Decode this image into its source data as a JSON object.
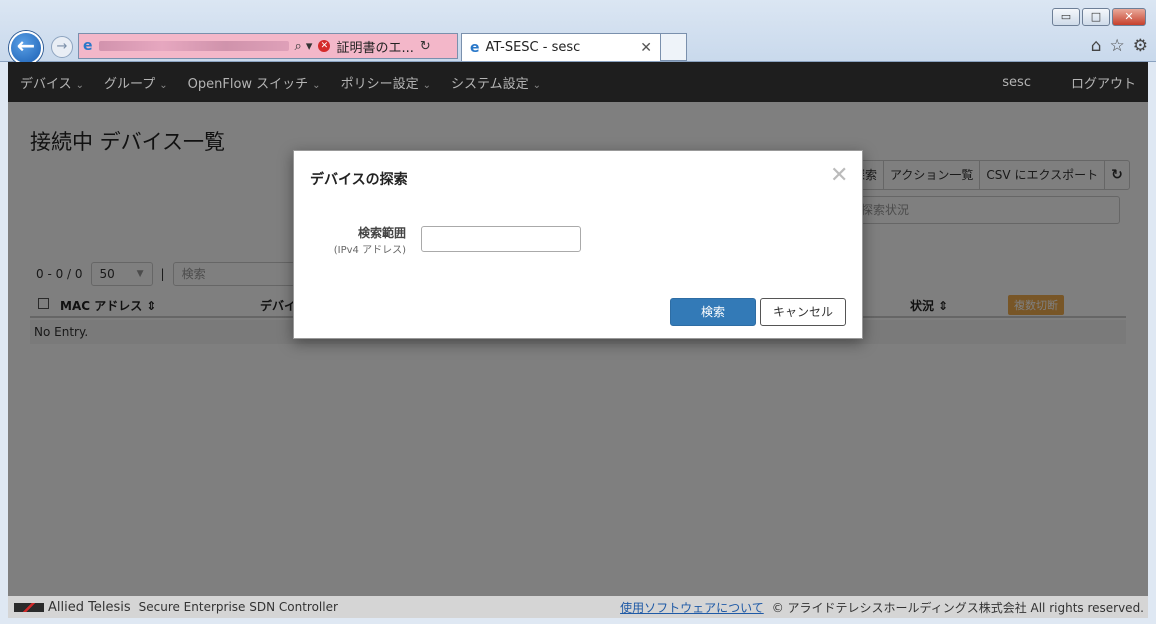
{
  "browser": {
    "window_buttons": {
      "minimize": "▭",
      "maximize": "□",
      "close": "✕"
    },
    "address": {
      "error_label": "証明書のエ...",
      "search_glyph": "⌕ ▾",
      "refresh_glyph": "↻"
    },
    "tab": {
      "title": "AT-SESC - sesc",
      "close": "✕"
    },
    "tools": {
      "home": "⌂",
      "favorites": "☆",
      "settings": "⚙"
    }
  },
  "navbar": {
    "items": [
      {
        "label": "デバイス"
      },
      {
        "label": "グループ"
      },
      {
        "label": "OpenFlow スイッチ"
      },
      {
        "label": "ポリシー設定"
      },
      {
        "label": "システム設定"
      }
    ],
    "caret": "⌄",
    "user": "sesc",
    "logout": "ログアウト"
  },
  "page": {
    "title": "接続中 デバイス一覧",
    "buttons": {
      "search": "探索",
      "actions": "アクション一覧",
      "csv": "CSV にエクスポート",
      "refresh": "↻"
    },
    "search_status_placeholder": "探索状況",
    "pager": {
      "range": "0 - 0 / 0",
      "per_page": "50",
      "separator": "|",
      "filter_placeholder": "検索"
    },
    "table": {
      "columns": {
        "mac": "MAC アドレス ⇕",
        "device": "デバイ",
        "status": "状況 ⇕"
      },
      "badge": "複数切断",
      "empty": "No Entry."
    }
  },
  "footer": {
    "brand": "Allied Telesis",
    "product": "Secure Enterprise SDN Controller",
    "link": "使用ソフトウェアについて",
    "copyright": "© アライドテレシスホールディングス株式会社 All rights reserved."
  },
  "modal": {
    "title": "デバイスの探索",
    "close": "✕",
    "field_label": "検索範囲",
    "field_sub": "(IPv4 アドレス)",
    "field_value": "",
    "submit": "検索",
    "cancel": "キャンセル"
  }
}
